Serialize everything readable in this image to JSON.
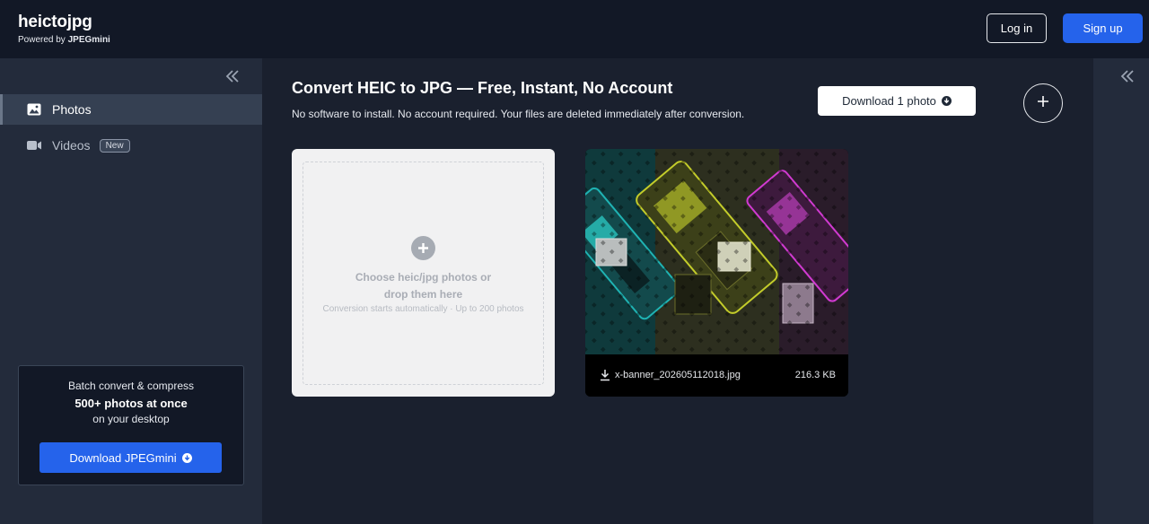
{
  "header": {
    "brand_name": "heictojpg",
    "brand_powered_prefix": "Powered by",
    "brand_powered_name": "JPEGmini",
    "login_label": "Log in",
    "signup_label": "Sign up"
  },
  "sidebar": {
    "items": [
      {
        "label": "Photos",
        "icon": "image-icon",
        "active": true
      },
      {
        "label": "Videos",
        "icon": "video-camera-icon",
        "badge": "New"
      }
    ],
    "promo": {
      "line1": "Batch convert & compress",
      "line2": "500+ photos at once",
      "line3": "on your desktop",
      "button_label": "Download JPEGmini"
    }
  },
  "main": {
    "title": "Convert HEIC to JPG — Free, Instant, No Account",
    "subtitle": "No software to install. No account required. Your files are deleted immediately after conversion.",
    "download_button_label": "Download 1 photo",
    "dropzone": {
      "line1": "Choose heic/jpg photos or",
      "line2": "drop them here",
      "hint": "Conversion starts automatically · Up to 200 photos"
    },
    "photos": [
      {
        "filename": "x-banner_202605112018.jpg",
        "size": "216.3 KB"
      }
    ]
  },
  "colors": {
    "background": "#1a202e",
    "topbar": "#121826",
    "sidebar": "#232b3b",
    "accent": "#2563eb",
    "dropzone": "#f1f1f2"
  }
}
